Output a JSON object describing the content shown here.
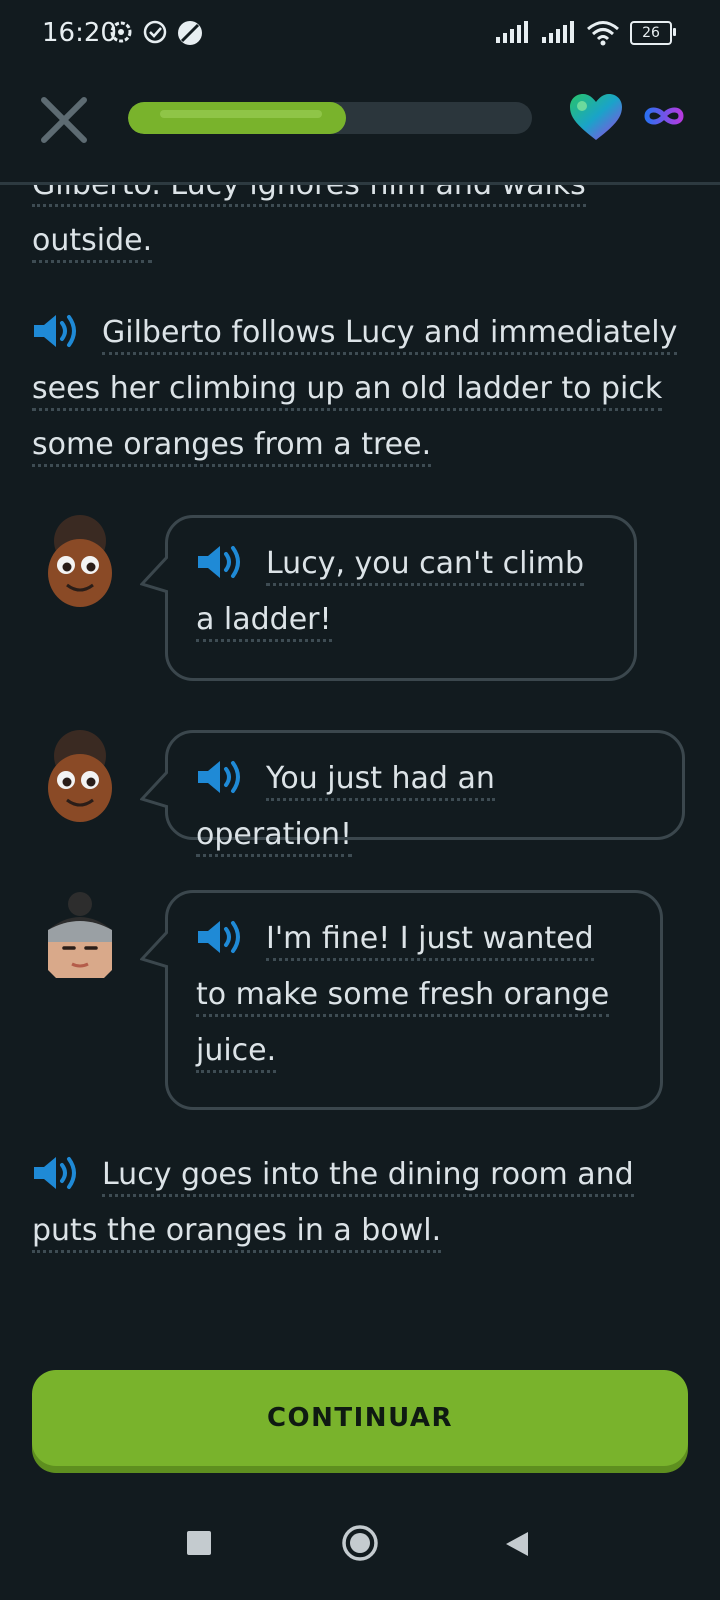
{
  "status_bar": {
    "time": "16:20",
    "battery": "26"
  },
  "header": {
    "progress_fraction": 0.54,
    "close_label": "close",
    "accent": "#79b32c"
  },
  "story": {
    "intro_fragment": "Gilberto. Lucy ignores him and walks",
    "intro_line2": "outside.",
    "narration_1": "Gilberto follows Lucy and immediately sees her climbing up an old ladder to pick some oranges from a tree.",
    "dialogue": [
      {
        "speaker": "Gilberto",
        "text": "Lucy, you can't climb a ladder!"
      },
      {
        "speaker": "Gilberto",
        "text": "You just had an operation!"
      },
      {
        "speaker": "Lucy",
        "text": "I'm fine! I just wanted to make some fresh orange juice."
      }
    ],
    "narration_2": "Lucy goes into the dining room and puts the oranges in a bowl."
  },
  "footer": {
    "continue_label": "CONTINUAR"
  },
  "colors": {
    "background": "#121b1f",
    "speaker_blue": "#1f8ad6",
    "bubble_border": "#3b474d"
  }
}
